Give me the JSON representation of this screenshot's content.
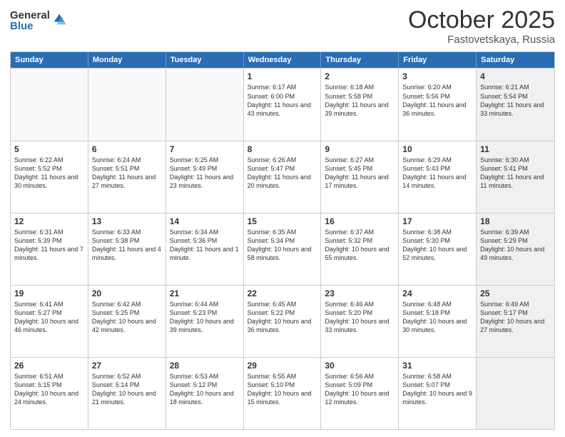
{
  "logo": {
    "general": "General",
    "blue": "Blue"
  },
  "title": "October 2025",
  "location": "Fastovetskaya, Russia",
  "header_days": [
    "Sunday",
    "Monday",
    "Tuesday",
    "Wednesday",
    "Thursday",
    "Friday",
    "Saturday"
  ],
  "rows": [
    [
      {
        "day": "",
        "text": "",
        "empty": true
      },
      {
        "day": "",
        "text": "",
        "empty": true
      },
      {
        "day": "",
        "text": "",
        "empty": true
      },
      {
        "day": "1",
        "text": "Sunrise: 6:17 AM\nSunset: 6:00 PM\nDaylight: 11 hours\nand 43 minutes."
      },
      {
        "day": "2",
        "text": "Sunrise: 6:18 AM\nSunset: 5:58 PM\nDaylight: 11 hours\nand 39 minutes."
      },
      {
        "day": "3",
        "text": "Sunrise: 6:20 AM\nSunset: 5:56 PM\nDaylight: 11 hours\nand 36 minutes."
      },
      {
        "day": "4",
        "text": "Sunrise: 6:21 AM\nSunset: 5:54 PM\nDaylight: 11 hours\nand 33 minutes.",
        "shaded": true
      }
    ],
    [
      {
        "day": "5",
        "text": "Sunrise: 6:22 AM\nSunset: 5:52 PM\nDaylight: 11 hours\nand 30 minutes."
      },
      {
        "day": "6",
        "text": "Sunrise: 6:24 AM\nSunset: 5:51 PM\nDaylight: 11 hours\nand 27 minutes."
      },
      {
        "day": "7",
        "text": "Sunrise: 6:25 AM\nSunset: 5:49 PM\nDaylight: 11 hours\nand 23 minutes."
      },
      {
        "day": "8",
        "text": "Sunrise: 6:26 AM\nSunset: 5:47 PM\nDaylight: 11 hours\nand 20 minutes."
      },
      {
        "day": "9",
        "text": "Sunrise: 6:27 AM\nSunset: 5:45 PM\nDaylight: 11 hours\nand 17 minutes."
      },
      {
        "day": "10",
        "text": "Sunrise: 6:29 AM\nSunset: 5:43 PM\nDaylight: 11 hours\nand 14 minutes."
      },
      {
        "day": "11",
        "text": "Sunrise: 6:30 AM\nSunset: 5:41 PM\nDaylight: 11 hours\nand 11 minutes.",
        "shaded": true
      }
    ],
    [
      {
        "day": "12",
        "text": "Sunrise: 6:31 AM\nSunset: 5:39 PM\nDaylight: 11 hours\nand 7 minutes."
      },
      {
        "day": "13",
        "text": "Sunrise: 6:33 AM\nSunset: 5:38 PM\nDaylight: 11 hours\nand 4 minutes."
      },
      {
        "day": "14",
        "text": "Sunrise: 6:34 AM\nSunset: 5:36 PM\nDaylight: 11 hours\nand 1 minute."
      },
      {
        "day": "15",
        "text": "Sunrise: 6:35 AM\nSunset: 5:34 PM\nDaylight: 10 hours\nand 58 minutes."
      },
      {
        "day": "16",
        "text": "Sunrise: 6:37 AM\nSunset: 5:32 PM\nDaylight: 10 hours\nand 55 minutes."
      },
      {
        "day": "17",
        "text": "Sunrise: 6:38 AM\nSunset: 5:30 PM\nDaylight: 10 hours\nand 52 minutes."
      },
      {
        "day": "18",
        "text": "Sunrise: 6:39 AM\nSunset: 5:29 PM\nDaylight: 10 hours\nand 49 minutes.",
        "shaded": true
      }
    ],
    [
      {
        "day": "19",
        "text": "Sunrise: 6:41 AM\nSunset: 5:27 PM\nDaylight: 10 hours\nand 46 minutes."
      },
      {
        "day": "20",
        "text": "Sunrise: 6:42 AM\nSunset: 5:25 PM\nDaylight: 10 hours\nand 42 minutes."
      },
      {
        "day": "21",
        "text": "Sunrise: 6:44 AM\nSunset: 5:23 PM\nDaylight: 10 hours\nand 39 minutes."
      },
      {
        "day": "22",
        "text": "Sunrise: 6:45 AM\nSunset: 5:22 PM\nDaylight: 10 hours\nand 36 minutes."
      },
      {
        "day": "23",
        "text": "Sunrise: 6:46 AM\nSunset: 5:20 PM\nDaylight: 10 hours\nand 33 minutes."
      },
      {
        "day": "24",
        "text": "Sunrise: 6:48 AM\nSunset: 5:18 PM\nDaylight: 10 hours\nand 30 minutes."
      },
      {
        "day": "25",
        "text": "Sunrise: 6:49 AM\nSunset: 5:17 PM\nDaylight: 10 hours\nand 27 minutes.",
        "shaded": true
      }
    ],
    [
      {
        "day": "26",
        "text": "Sunrise: 6:51 AM\nSunset: 5:15 PM\nDaylight: 10 hours\nand 24 minutes."
      },
      {
        "day": "27",
        "text": "Sunrise: 6:52 AM\nSunset: 5:14 PM\nDaylight: 10 hours\nand 21 minutes."
      },
      {
        "day": "28",
        "text": "Sunrise: 6:53 AM\nSunset: 5:12 PM\nDaylight: 10 hours\nand 18 minutes."
      },
      {
        "day": "29",
        "text": "Sunrise: 6:55 AM\nSunset: 5:10 PM\nDaylight: 10 hours\nand 15 minutes."
      },
      {
        "day": "30",
        "text": "Sunrise: 6:56 AM\nSunset: 5:09 PM\nDaylight: 10 hours\nand 12 minutes."
      },
      {
        "day": "31",
        "text": "Sunrise: 6:58 AM\nSunset: 5:07 PM\nDaylight: 10 hours\nand 9 minutes."
      },
      {
        "day": "",
        "text": "",
        "empty": true,
        "shaded": true
      }
    ]
  ]
}
